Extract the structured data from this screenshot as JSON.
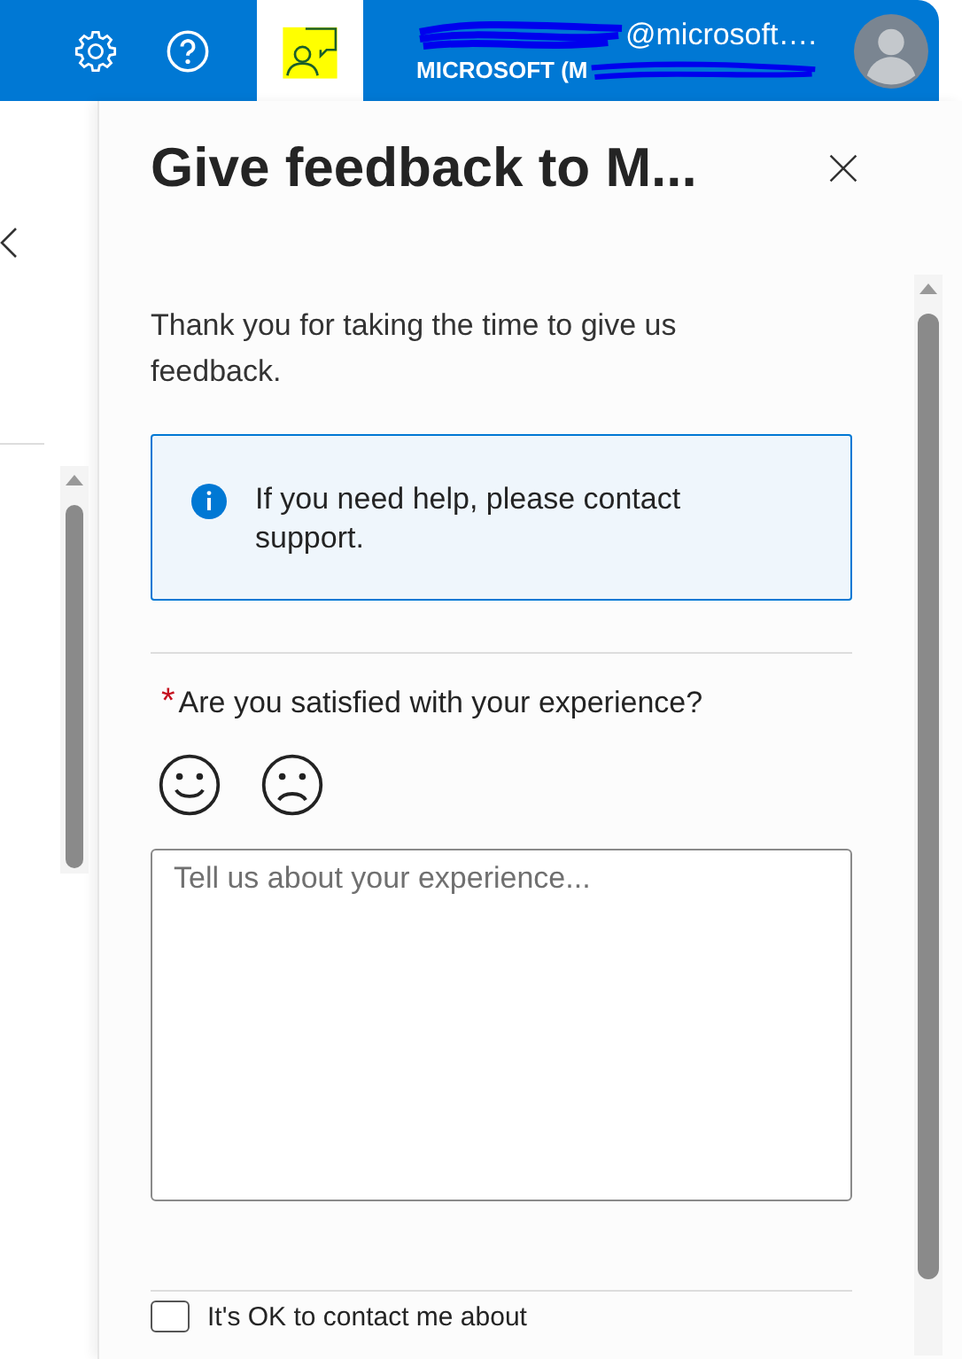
{
  "top_bar": {
    "account_name": "@microsoft….",
    "account_org": "MICROSOFT (M",
    "feedback_selected": true
  },
  "panel": {
    "title": "Give feedback to M...",
    "intro": "Thank you for taking the time to give us feedback.",
    "info": "If you need help, please contact support.",
    "question": {
      "required": true,
      "marker": "*",
      "label": "Are you satisfied with your experience?"
    },
    "ratings": [
      {
        "kind": "happy",
        "selected": false
      },
      {
        "kind": "sad",
        "selected": false
      }
    ],
    "comment": {
      "placeholder": "Tell us about your experience..."
    },
    "contact": {
      "label": "It's OK to contact me about",
      "checked": false
    }
  }
}
